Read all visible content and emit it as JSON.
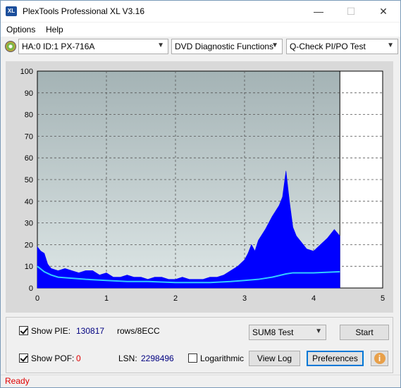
{
  "window": {
    "title": "PlexTools Professional XL V3.16",
    "icon_label": "XL"
  },
  "menu": {
    "items": [
      {
        "label": "Options"
      },
      {
        "label": "Help"
      }
    ]
  },
  "toolbar": {
    "drive": "HA:0 ID:1  PX-716A",
    "function": "DVD Diagnostic Functions",
    "test": "Q-Check PI/PO Test"
  },
  "chart_data": {
    "type": "area",
    "y_ticks": [
      "100",
      "90",
      "80",
      "70",
      "60",
      "50",
      "40",
      "30",
      "20",
      "10",
      "0"
    ],
    "x_ticks": [
      "0",
      "1",
      "2",
      "3",
      "4",
      "5"
    ],
    "xlim": [
      0,
      5
    ],
    "ylim": [
      0,
      100
    ],
    "grid": true,
    "data_end_x": 4.38,
    "series": [
      {
        "kind": "PIE",
        "color": "#0000ff",
        "x": [
          0,
          0.05,
          0.1,
          0.15,
          0.2,
          0.3,
          0.4,
          0.5,
          0.6,
          0.7,
          0.8,
          0.9,
          1.0,
          1.1,
          1.2,
          1.3,
          1.4,
          1.5,
          1.6,
          1.7,
          1.8,
          1.9,
          2.0,
          2.1,
          2.2,
          2.3,
          2.4,
          2.5,
          2.6,
          2.7,
          2.8,
          2.9,
          3.0,
          3.05,
          3.1,
          3.15,
          3.2,
          3.3,
          3.4,
          3.5,
          3.55,
          3.6,
          3.65,
          3.7,
          3.75,
          3.8,
          3.9,
          4.0,
          4.1,
          4.2,
          4.3,
          4.38
        ],
        "y": [
          19,
          17,
          16,
          11,
          9,
          8,
          9,
          8,
          7,
          8,
          8,
          6,
          7,
          5,
          5,
          6,
          5,
          5,
          4,
          5,
          5,
          4,
          4,
          5,
          4,
          4,
          4,
          5,
          5,
          6,
          8,
          10,
          13,
          16,
          20,
          17,
          22,
          27,
          33,
          38,
          42,
          54,
          40,
          28,
          24,
          22,
          18,
          17,
          20,
          23,
          27,
          24
        ]
      },
      {
        "kind": "PIE average",
        "color": "#33ccff",
        "x": [
          0,
          0.1,
          0.2,
          0.3,
          0.5,
          0.7,
          1.0,
          1.3,
          1.6,
          2.0,
          2.5,
          2.8,
          3.0,
          3.2,
          3.4,
          3.6,
          3.7,
          4.0,
          4.38
        ],
        "y": [
          10,
          7.5,
          6,
          5,
          4.5,
          4,
          3.5,
          3,
          3,
          2.5,
          2.5,
          3,
          3.5,
          4,
          5,
          6.5,
          7,
          7,
          7.5
        ]
      }
    ]
  },
  "controls": {
    "show_pie_label": "Show PIE:",
    "pie_value": "130817",
    "pie_unit": "rows/8ECC",
    "show_pof_label": "Show POF:",
    "pof_value": "0",
    "lsn_label": "LSN:",
    "lsn_value": "2298496",
    "logarithmic_label": "Logarithmic",
    "sum_test": "SUM8 Test",
    "start_label": "Start",
    "view_log_label": "View Log",
    "preferences_label": "Preferences",
    "info_icon_glyph": "i",
    "show_pie_checked": true,
    "show_pof_checked": true,
    "logarithmic_checked": false
  },
  "status": {
    "text": "Ready",
    "color": "#e00000"
  },
  "colors": {
    "pie_value": "#000080",
    "pof_value": "#e00000"
  }
}
